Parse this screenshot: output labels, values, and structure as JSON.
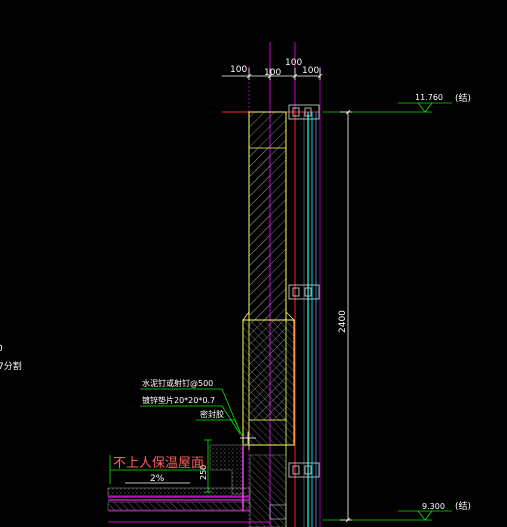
{
  "colors": {
    "background": "#000000",
    "dimension": "#ffffff",
    "wall_outline": "#ffff55",
    "hatch": "#bbbbbb",
    "reference_line": "#ff2222",
    "grid_line": "#cc00cc",
    "elevation_mark": "#00dd00",
    "glass_panel": "#00cccc",
    "annotation_leader": "#00ee00",
    "roof_label": "#ff6060"
  },
  "dimensions_top": [
    "100",
    "100",
    "100",
    "100"
  ],
  "dimension_vertical": "2400",
  "dimension_small": "250",
  "elevations": {
    "top": {
      "value": "11.760",
      "note": "(结)"
    },
    "bottom": {
      "value": "9.300",
      "note": "(结)"
    }
  },
  "annotations": {
    "line1": "水泥钉或射钉@500",
    "line2": "镀锌垫片20*20*0.7",
    "line3": "密封胶"
  },
  "roof": {
    "title": "不上人保温屋面",
    "slope": "2%"
  },
  "left_edge": {
    "fragment1": "0",
    "fragment2": "7分割"
  }
}
